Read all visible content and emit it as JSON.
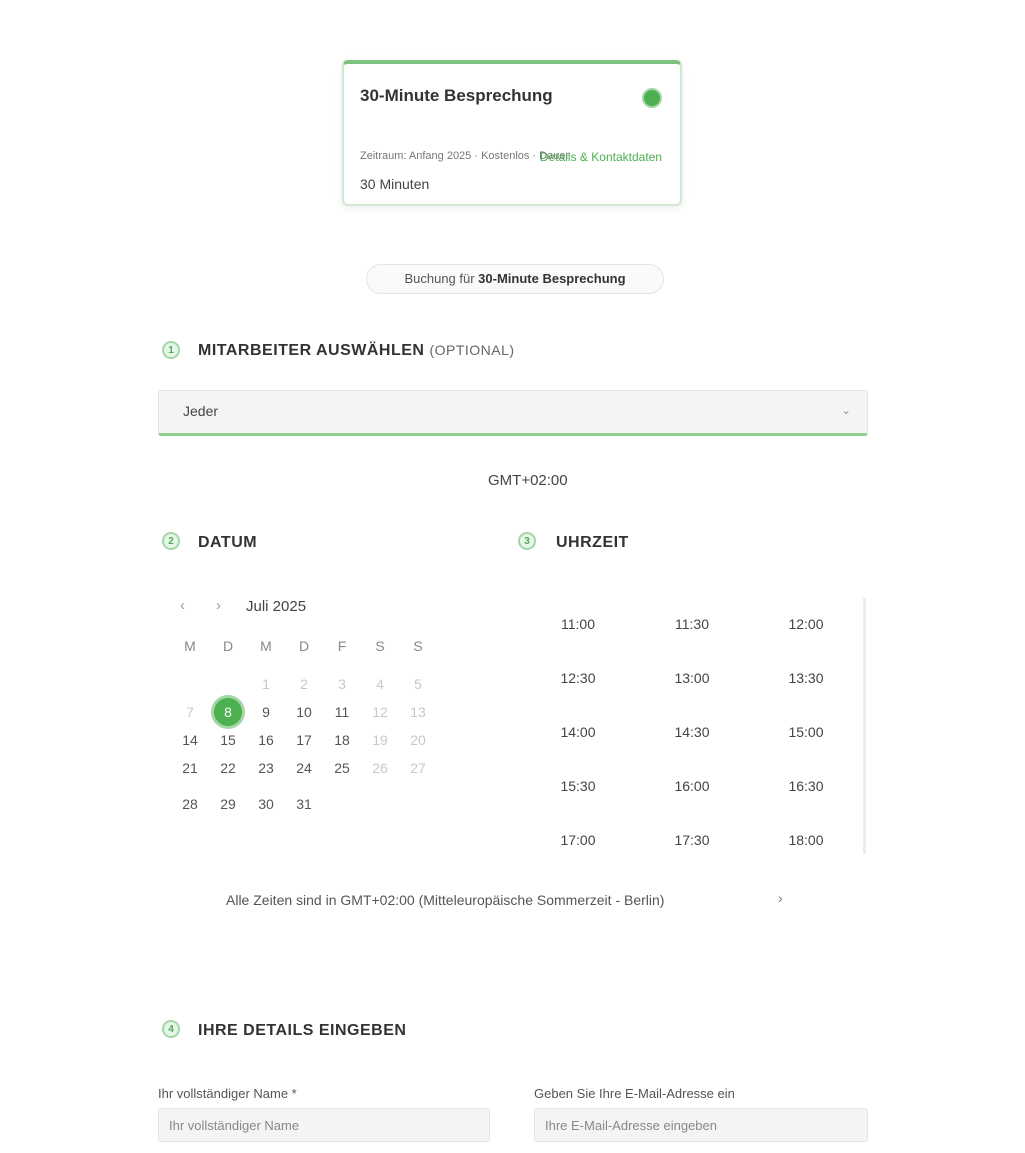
{
  "service": {
    "title": "30-Minute Besprechung",
    "meta": "Zeitraum: Anfang 2025 · Kostenlos · Dauer",
    "link": "Details & Kontaktdaten",
    "duration": "30 Minuten"
  },
  "pill": {
    "prefix": "Buchung für ",
    "name": "30-Minute Besprechung"
  },
  "sections": {
    "staff": {
      "number": "1",
      "title": "MITARBEITER AUSWÄHLEN",
      "optional": "(OPTIONAL)"
    },
    "date": {
      "number": "2",
      "title": "DATUM"
    },
    "time": {
      "number": "3",
      "title": "UHRZEIT"
    },
    "details": {
      "number": "4",
      "title": "IHRE DETAILS EINGEBEN"
    }
  },
  "staff_select": {
    "value": "Jeder",
    "arrow": "⌄"
  },
  "timezone_label": "GMT+02:00",
  "calendar": {
    "prev": "‹",
    "next": "›",
    "month": "Juli 2025",
    "weekdays": [
      "M",
      "D",
      "M",
      "D",
      "F",
      "S",
      "S"
    ],
    "weeks": [
      [
        {
          "d": ""
        },
        {
          "d": ""
        },
        {
          "d": "1",
          "dim": true
        },
        {
          "d": "2",
          "dim": true
        },
        {
          "d": "3",
          "dim": true
        },
        {
          "d": "4",
          "dim": true
        },
        {
          "d": "5",
          "dim": true
        }
      ],
      [
        {
          "d": "7",
          "dim": true
        },
        {
          "d": "8",
          "sel": true
        },
        {
          "d": "9"
        },
        {
          "d": "10"
        },
        {
          "d": "11"
        },
        {
          "d": "12",
          "dim": true
        },
        {
          "d": "13",
          "dim": true
        }
      ],
      [
        {
          "d": "14"
        },
        {
          "d": "15"
        },
        {
          "d": "16"
        },
        {
          "d": "17"
        },
        {
          "d": "18"
        },
        {
          "d": "19",
          "dim": true
        },
        {
          "d": "20",
          "dim": true
        }
      ],
      [
        {
          "d": "21"
        },
        {
          "d": "22"
        },
        {
          "d": "23"
        },
        {
          "d": "24"
        },
        {
          "d": "25"
        },
        {
          "d": "26",
          "dim": true
        },
        {
          "d": "27",
          "dim": true
        }
      ],
      [
        {
          "d": "28"
        },
        {
          "d": "29"
        },
        {
          "d": "30"
        },
        {
          "d": "31"
        },
        {
          "d": ""
        },
        {
          "d": ""
        },
        {
          "d": ""
        }
      ]
    ]
  },
  "times": [
    [
      "11:00",
      "11:30",
      "12:00"
    ],
    [
      "12:30",
      "13:00",
      "13:30"
    ],
    [
      "14:00",
      "14:30",
      "15:00"
    ],
    [
      "15:30",
      "16:00",
      "16:30"
    ],
    [
      "17:00",
      "17:30",
      "18:00"
    ]
  ],
  "timezone_note": "Alle Zeiten sind in GMT+02:00 (Mitteleuropäische Sommerzeit - Berlin)",
  "timezone_toggle": "›",
  "form": {
    "name_label": "Ihr vollständiger Name *",
    "name_placeholder": "Ihr vollständiger Name",
    "email_label": "Geben Sie Ihre E-Mail-Adresse ein",
    "email_placeholder": "Ihre E-Mail-Adresse eingeben"
  }
}
